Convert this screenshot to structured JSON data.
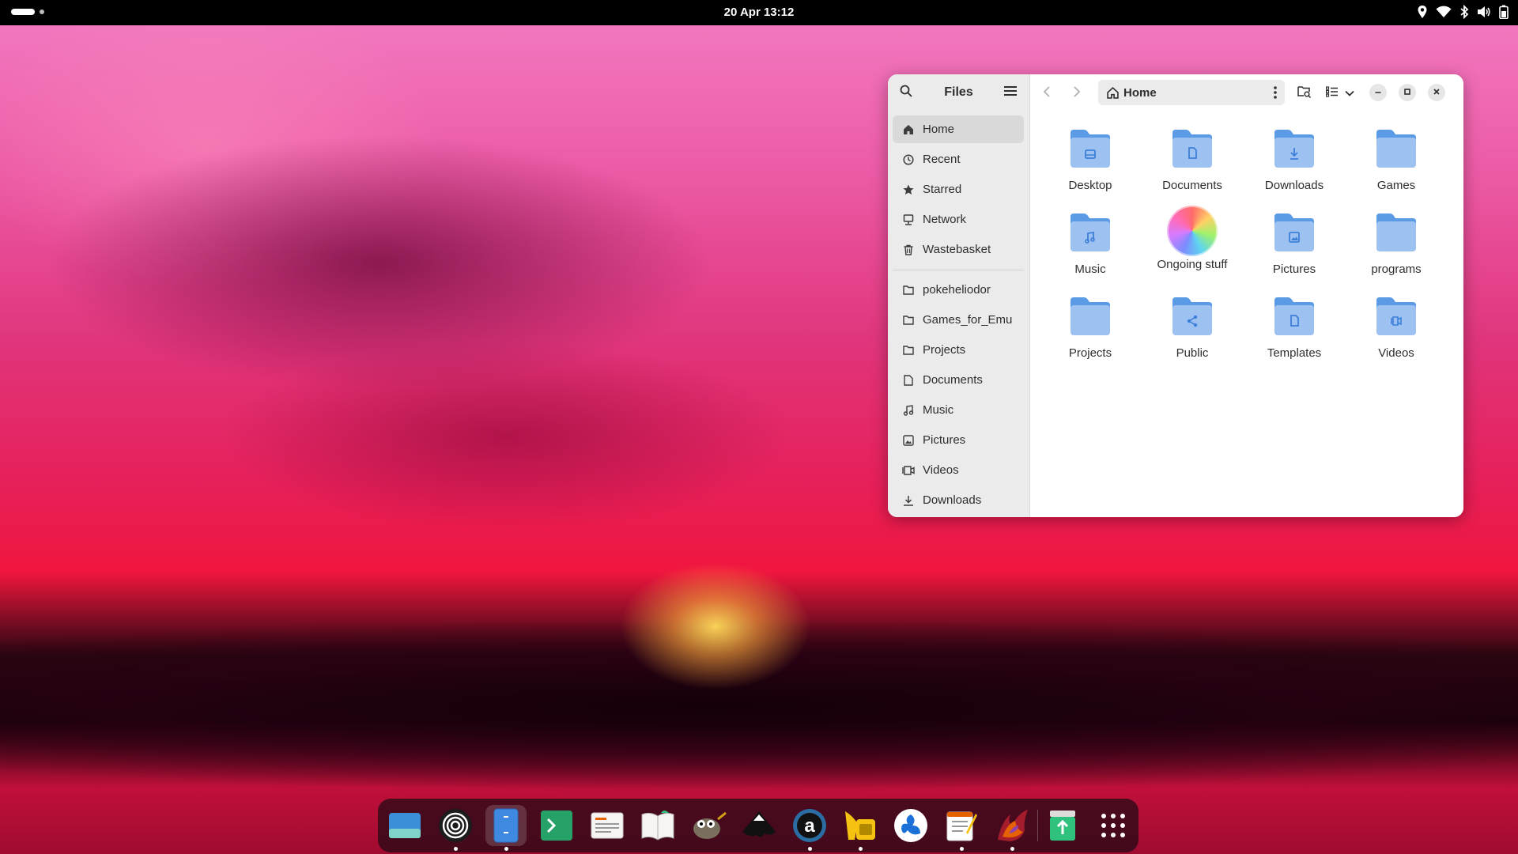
{
  "topbar": {
    "clock": "20 Apr  13:12",
    "tray_icons": [
      "location-icon",
      "wifi-icon",
      "bluetooth-icon",
      "volume-icon",
      "battery-icon"
    ]
  },
  "window": {
    "sidebar_title": "Files",
    "sidebar": {
      "places": [
        {
          "label": "Home",
          "icon": "home-icon",
          "selected": true
        },
        {
          "label": "Recent",
          "icon": "clock-icon"
        },
        {
          "label": "Starred",
          "icon": "star-icon"
        },
        {
          "label": "Network",
          "icon": "network-icon"
        },
        {
          "label": "Wastebasket",
          "icon": "trash-icon"
        }
      ],
      "bookmarks": [
        {
          "label": "pokeheliodor",
          "icon": "folder-icon"
        },
        {
          "label": "Games_for_Emu",
          "icon": "folder-icon"
        },
        {
          "label": "Projects",
          "icon": "folder-icon"
        },
        {
          "label": "Documents",
          "icon": "document-icon"
        },
        {
          "label": "Music",
          "icon": "music-icon"
        },
        {
          "label": "Pictures",
          "icon": "picture-icon"
        },
        {
          "label": "Videos",
          "icon": "video-icon"
        },
        {
          "label": "Downloads",
          "icon": "download-icon"
        }
      ]
    },
    "path": "Home",
    "folders": [
      {
        "label": "Desktop",
        "emblem": "desktop"
      },
      {
        "label": "Documents",
        "emblem": "document"
      },
      {
        "label": "Downloads",
        "emblem": "download"
      },
      {
        "label": "Games",
        "emblem": "none"
      },
      {
        "label": "Music",
        "emblem": "music"
      },
      {
        "label": "Ongoing stuff",
        "emblem": "color-wheel"
      },
      {
        "label": "Pictures",
        "emblem": "picture"
      },
      {
        "label": "programs",
        "emblem": "none"
      },
      {
        "label": "Projects",
        "emblem": "none"
      },
      {
        "label": "Public",
        "emblem": "share"
      },
      {
        "label": "Templates",
        "emblem": "document"
      },
      {
        "label": "Videos",
        "emblem": "video"
      }
    ]
  },
  "dock": {
    "apps": [
      {
        "name": "files-drawer-app-icon",
        "running": false
      },
      {
        "name": "podcasts-app-icon",
        "running": true
      },
      {
        "name": "files-app-icon",
        "running": true,
        "active": true
      },
      {
        "name": "terminal-app-icon",
        "running": false
      },
      {
        "name": "news-reader-app-icon",
        "running": false
      },
      {
        "name": "ebook-reader-app-icon",
        "running": false
      },
      {
        "name": "gimp-app-icon",
        "running": false
      },
      {
        "name": "inkscape-app-icon",
        "running": false
      },
      {
        "name": "audacious-app-icon",
        "running": true
      },
      {
        "name": "music-player-app-icon",
        "running": true
      },
      {
        "name": "flathub-app-icon",
        "running": false
      },
      {
        "name": "text-editor-app-icon",
        "running": true
      },
      {
        "name": "browser-app-icon",
        "running": true
      },
      {
        "name": "recycle-app-icon",
        "running": false
      },
      {
        "name": "show-apps-icon",
        "running": false
      }
    ]
  },
  "colors": {
    "folder_body": "#9dc1f0",
    "folder_tab": "#5b9be6",
    "folder_emblem": "#3c7fd8",
    "topbar": "#000000"
  }
}
